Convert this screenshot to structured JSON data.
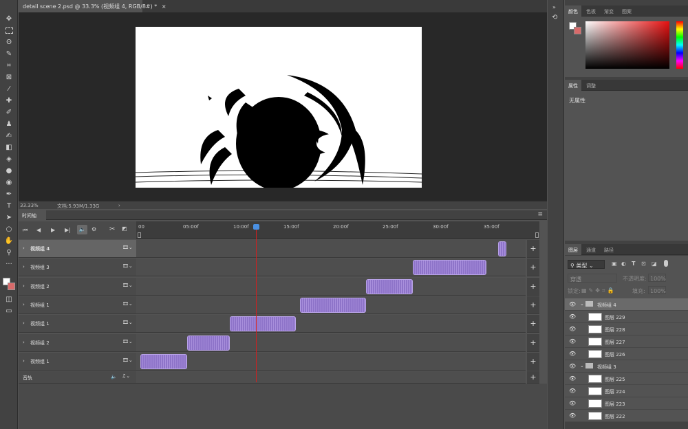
{
  "document": {
    "tab_title": "detail scene 2.psd @ 33.3% (视频组 4, RGB/8#) *",
    "zoom": "33.33%",
    "doc_info": "文档:5.93M/1.33G"
  },
  "tools": [
    "move-icon",
    "marquee-icon",
    "lasso-icon",
    "quick-select-icon",
    "crop-icon",
    "frame-icon",
    "eyedropper-icon",
    "healing-icon",
    "brush-icon",
    "stamp-icon",
    "history-brush-icon",
    "eraser-icon",
    "bucket-icon",
    "blur-icon",
    "dodge-icon",
    "pen-icon",
    "type-icon",
    "path-select-icon",
    "shape-icon",
    "hand-icon",
    "zoom-icon",
    "more-icon"
  ],
  "timeline": {
    "tab": "时间轴",
    "ruler": [
      "00",
      "05:00f",
      "10:00f",
      "15:00f",
      "20:00f",
      "25:00f",
      "30:00f",
      "35:00f"
    ],
    "playhead_frame": "10:20f",
    "tracks": [
      {
        "name": "视频组 4",
        "selected": true,
        "clips": [
          [
            0.93,
            0.95
          ]
        ]
      },
      {
        "name": "视频组 3",
        "clips": [
          [
            0.71,
            0.9
          ]
        ]
      },
      {
        "name": "视频组 2",
        "clips": [
          [
            0.59,
            0.71
          ]
        ]
      },
      {
        "name": "视频组 1",
        "clips": [
          [
            0.42,
            0.59
          ]
        ]
      },
      {
        "name": "视频组 1",
        "clips": [
          [
            0.24,
            0.41
          ]
        ]
      },
      {
        "name": "视频组 2",
        "clips": [
          [
            0.13,
            0.24
          ]
        ]
      },
      {
        "name": "视频组 1",
        "clips": [
          [
            0.01,
            0.13
          ]
        ]
      }
    ],
    "audio_track": "音轨"
  },
  "panels": {
    "color_tabs": [
      "颜色",
      "色板",
      "渐变",
      "图案"
    ],
    "props_tabs": [
      "属性",
      "调整"
    ],
    "props_text": "无属性",
    "layers_tabs": [
      "图层",
      "通道",
      "路径"
    ],
    "kind_filter": "类型",
    "blend_mode": "穿透",
    "opacity_label": "不透明度:",
    "opacity": "100%",
    "lock_label": "锁定:",
    "fill_label": "填充:",
    "fill": "100%",
    "layers": [
      {
        "type": "group",
        "name": "视频组 4",
        "selected": true
      },
      {
        "type": "layer",
        "name": "图层 229"
      },
      {
        "type": "layer",
        "name": "图层 228"
      },
      {
        "type": "layer",
        "name": "图层 227"
      },
      {
        "type": "layer",
        "name": "图层 226"
      },
      {
        "type": "group",
        "name": "视频组 3"
      },
      {
        "type": "layer",
        "name": "图层 225"
      },
      {
        "type": "layer",
        "name": "图层 224"
      },
      {
        "type": "layer",
        "name": "图层 223"
      },
      {
        "type": "layer",
        "name": "图层 222"
      }
    ]
  },
  "colors": {
    "foreground": "#ffffff",
    "background": "#d86a6a",
    "clip": "#9b82d3",
    "playhead": "#d02020"
  }
}
